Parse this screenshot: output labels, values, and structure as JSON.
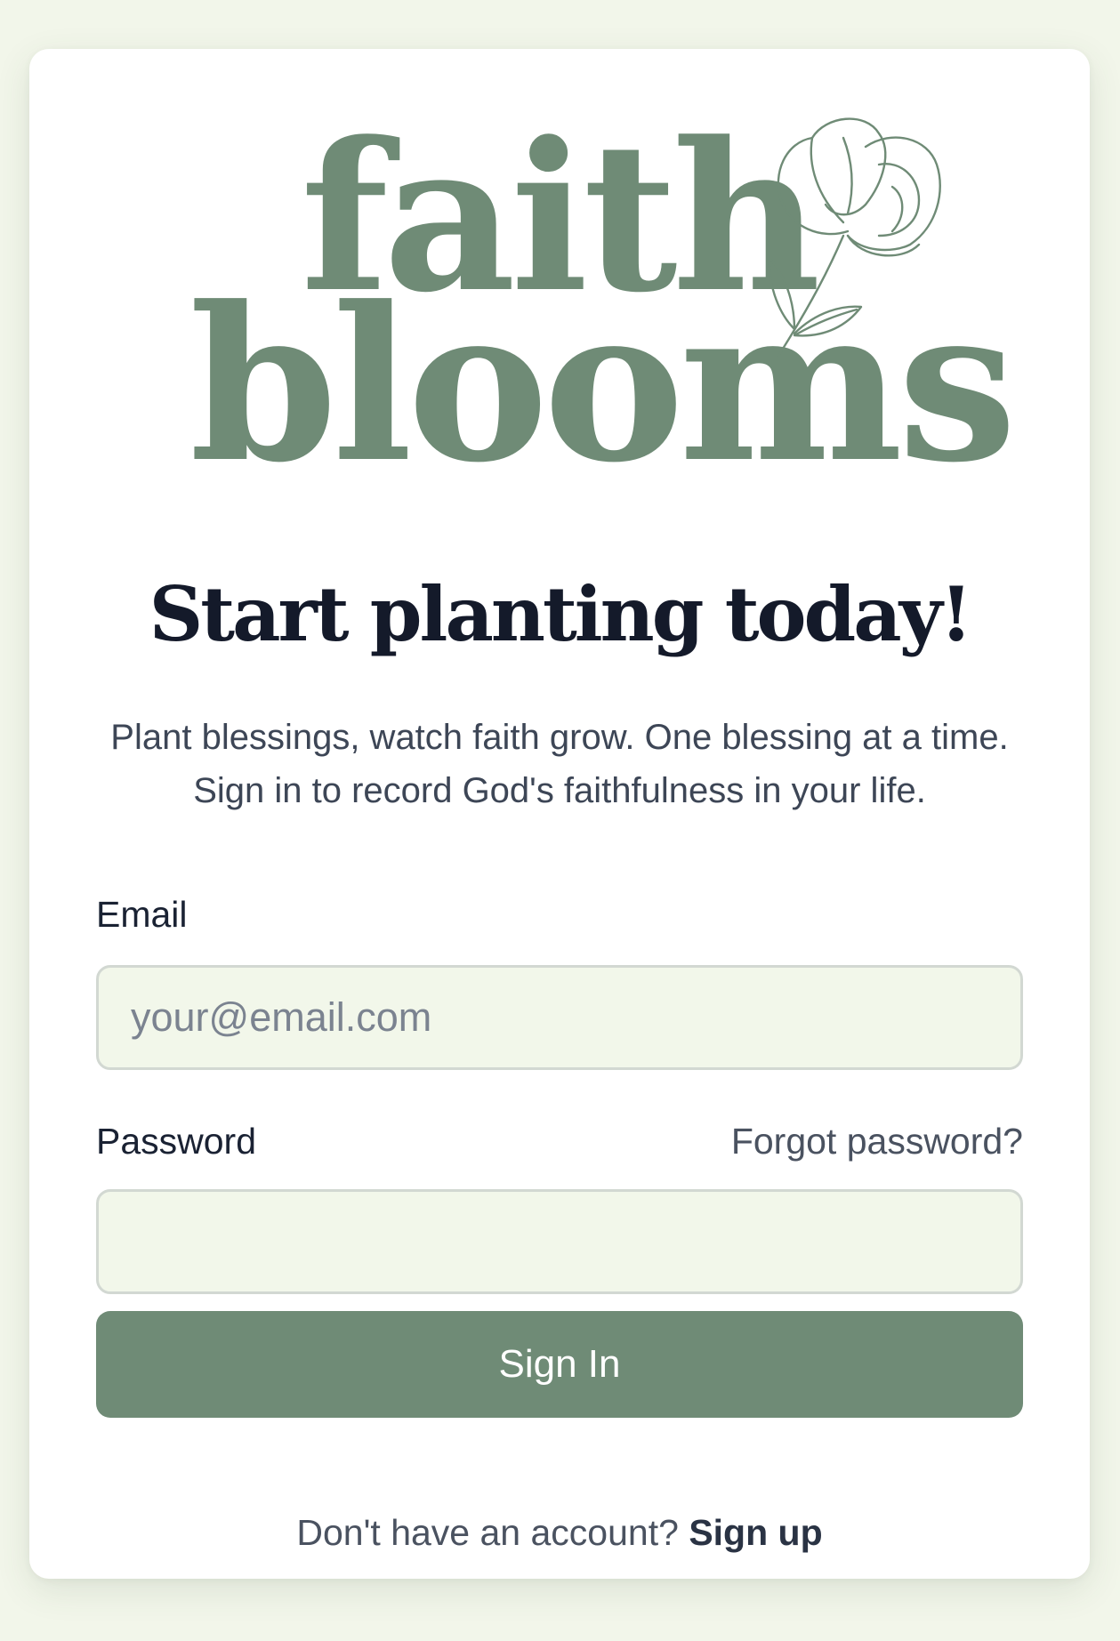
{
  "logo": {
    "line1": "faith",
    "line2": "blooms",
    "flower_icon": "flower-icon"
  },
  "heading": "Start planting today!",
  "subtitle": "Plant blessings, watch faith grow. One blessing at a time. Sign in to record God's faithfulness in your life.",
  "form": {
    "email_label": "Email",
    "email_placeholder": "your@email.com",
    "email_value": "",
    "password_label": "Password",
    "password_value": "",
    "forgot_label": "Forgot password?",
    "signin_label": "Sign In"
  },
  "footer": {
    "prompt": "Don't have an account?",
    "signup_label": "Sign up"
  },
  "colors": {
    "brand": "#6f8b76",
    "page_bg": "#f2f6ea",
    "input_bg": "#f2f7ea",
    "heading": "#141a2a"
  }
}
